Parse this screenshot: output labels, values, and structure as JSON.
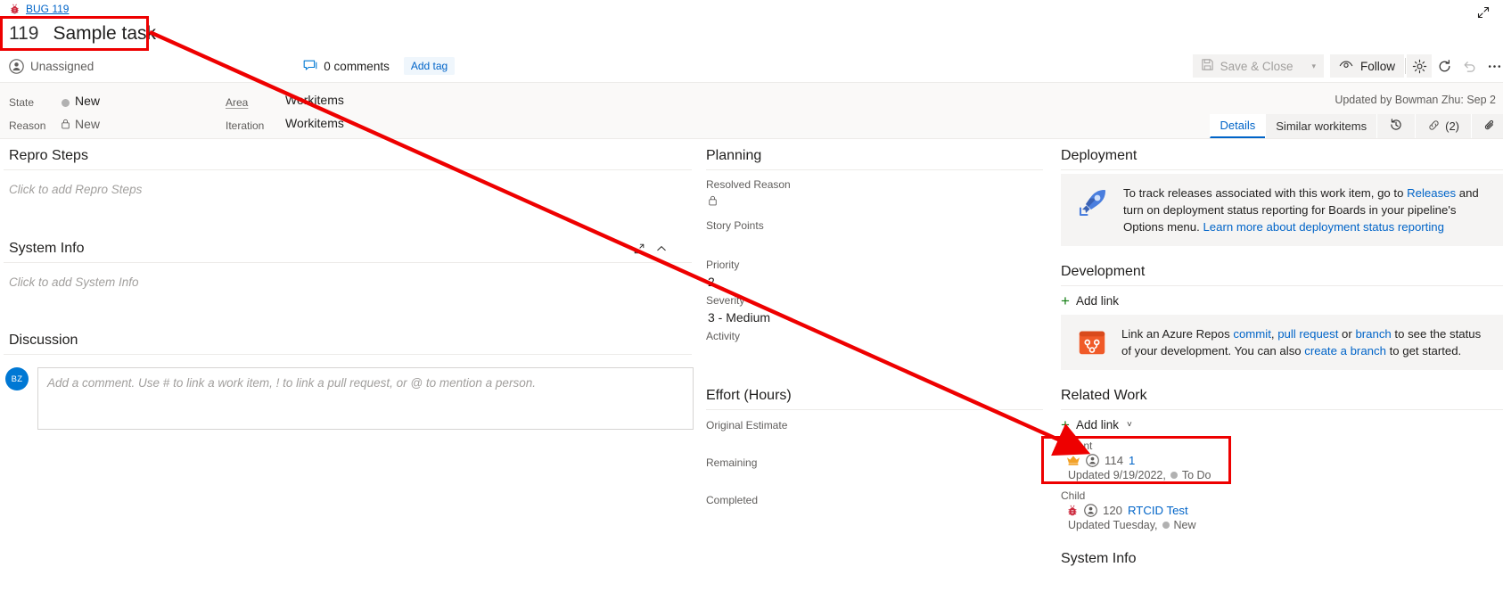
{
  "breadcrumb": {
    "icon": "bug-icon",
    "label": "BUG 119"
  },
  "header": {
    "id": "119",
    "title": "Sample task",
    "assigned_to": "Unassigned",
    "assigned_icon": "person-icon",
    "comments": "0 comments",
    "comments_icon": "comment-icon",
    "add_tag": "Add tag",
    "expand_icon": "expand-diagonal-icon"
  },
  "toolbar": {
    "save_close": "Save & Close",
    "save_icon": "save-disk-icon",
    "dropdown_caret": "▾",
    "follow": "Follow",
    "follow_icon": "eye-icon",
    "settings_icon": "gear-icon",
    "refresh_icon": "refresh-icon",
    "undo_icon": "undo-icon",
    "more_icon": "more-ellipsis-icon"
  },
  "fields": {
    "state_label": "State",
    "state_value": "New",
    "state_color": "#b1b1b1",
    "reason_label": "Reason",
    "reason_value": "New",
    "reason_icon": "lock-icon",
    "area_label": "Area",
    "area_value": "Workitems",
    "iteration_label": "Iteration",
    "iteration_value": "Workitems",
    "updated_by": "Updated by Bowman Zhu: Sep 2"
  },
  "tabs": [
    {
      "label": "Details",
      "active": true,
      "icon": null
    },
    {
      "label": "Similar workitems",
      "active": false,
      "icon": null
    },
    {
      "label": "",
      "active": false,
      "icon": "history-icon"
    },
    {
      "label": "(2)",
      "active": false,
      "icon": "link-icon"
    },
    {
      "label": "",
      "active": false,
      "icon": "attachment-icon"
    }
  ],
  "left_column": {
    "repro_steps": {
      "heading": "Repro Steps",
      "placeholder": "Click to add Repro Steps"
    },
    "system_info": {
      "heading": "System Info",
      "placeholder": "Click to add System Info",
      "expand_icon": "expand-diagonal-icon",
      "collapse_icon": "chevron-up-icon"
    },
    "discussion": {
      "heading": "Discussion",
      "avatar_initials": "BZ",
      "avatar_color": "#0078d4",
      "comment_placeholder": "Add a comment. Use # to link a work item, ! to link a pull request, or @ to mention a person."
    }
  },
  "mid_column": {
    "planning": {
      "heading": "Planning",
      "fields": [
        {
          "label": "Resolved Reason",
          "value": "",
          "icon": "lock-icon"
        },
        {
          "label": "Story Points",
          "value": "",
          "icon": null
        },
        {
          "label": "Priority",
          "value": "2",
          "icon": null
        },
        {
          "label": "Severity",
          "value": "3 - Medium",
          "icon": null
        },
        {
          "label": "Activity",
          "value": "",
          "icon": null
        }
      ]
    },
    "effort": {
      "heading": "Effort (Hours)",
      "fields": [
        {
          "label": "Original Estimate",
          "value": ""
        },
        {
          "label": "Remaining",
          "value": ""
        },
        {
          "label": "Completed",
          "value": ""
        }
      ]
    }
  },
  "right_column": {
    "deployment": {
      "heading": "Deployment",
      "icon": "rocket-icon",
      "text_part1": "To track releases associated with this work item, go to ",
      "link1": "Releases",
      "text_part2": " and turn on deployment status reporting for Boards in your pipeline's Options menu. ",
      "link2": "Learn more about deployment status reporting"
    },
    "development": {
      "heading": "Development",
      "add_link": "Add link",
      "icon": "azure-repos-icon",
      "text_part1": "Link an Azure Repos ",
      "link1": "commit",
      "text_sep1": ", ",
      "link2": "pull request",
      "text_part2": " or ",
      "link3": "branch",
      "text_part3": " to see the status of your development. You can also ",
      "link4": "create a branch",
      "text_part4": " to get started."
    },
    "related_work": {
      "heading": "Related Work",
      "add_link": "Add link",
      "add_link_caret": "˅",
      "groups": [
        {
          "label": "Parent",
          "items": [
            {
              "type_icon": "crown-icon",
              "person_icon": "person-circle-icon",
              "id": "114",
              "title": "1",
              "updated": "Updated 9/19/2022,",
              "state": "To Do",
              "state_color": "#b1b1b1"
            }
          ]
        },
        {
          "label": "Child",
          "items": [
            {
              "type_icon": "bug-icon",
              "person_icon": "person-circle-icon",
              "id": "120",
              "title": "RTCID Test",
              "updated": "Updated Tuesday,",
              "state": "New",
              "state_color": "#b1b1b1"
            }
          ]
        }
      ]
    },
    "system_info_heading": "System Info"
  },
  "annotations": {
    "highlight_color": "#ee0000",
    "rect_title": "title-highlight",
    "rect_parent": "parent-link-highlight",
    "arrow": "arrow-from-title-to-parent"
  }
}
